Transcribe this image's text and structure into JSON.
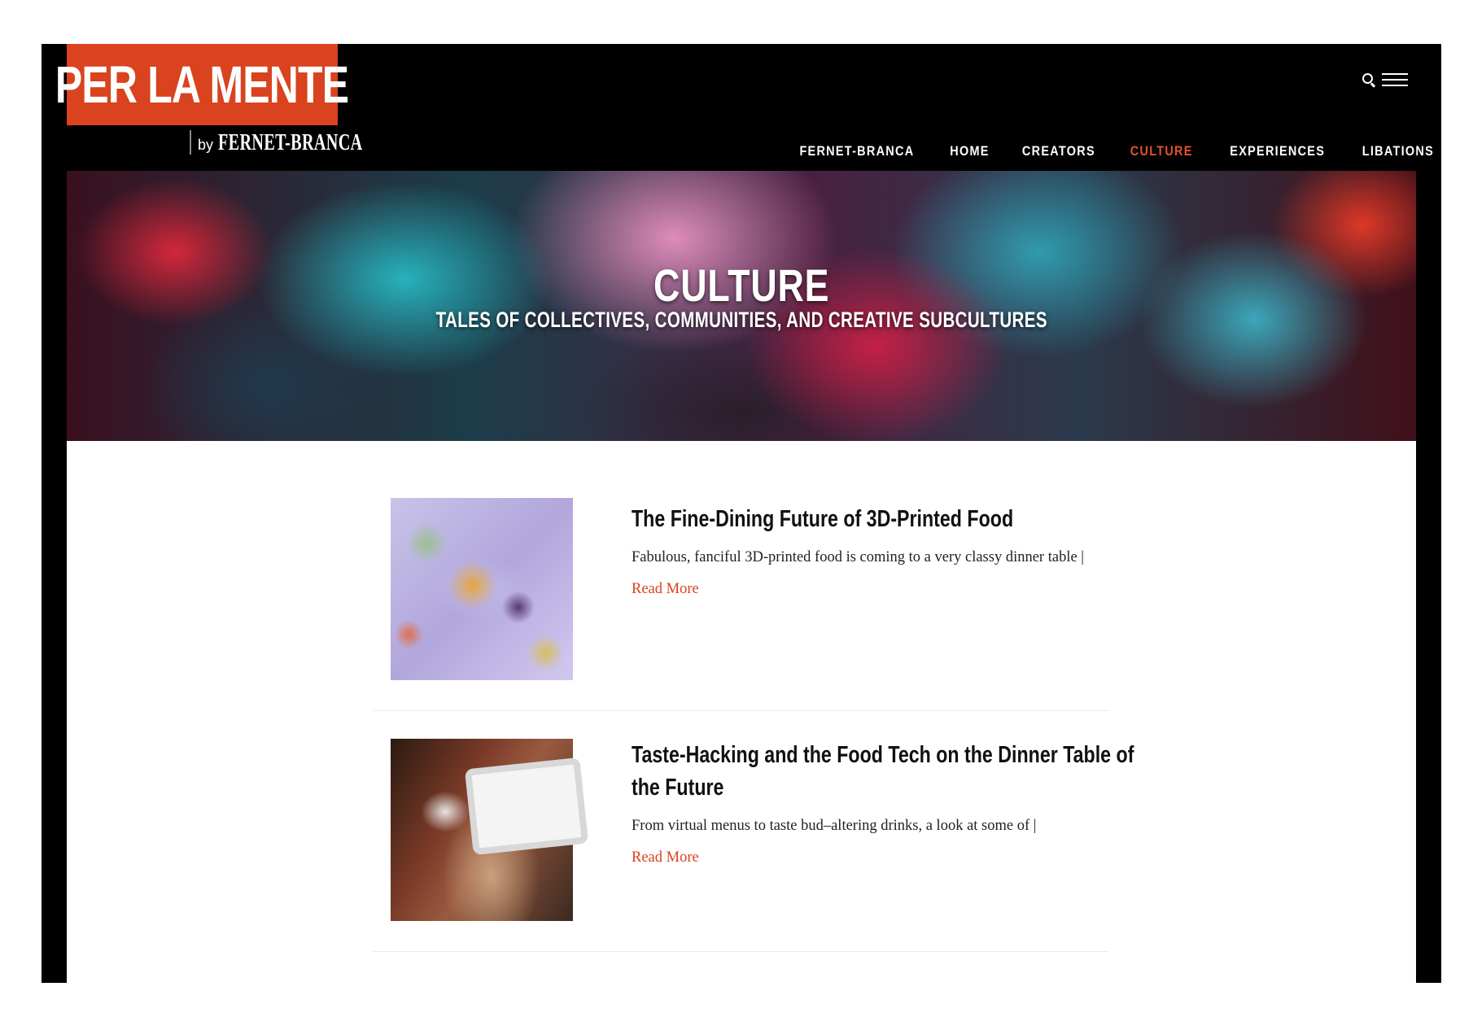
{
  "logo": {
    "title": "PER LA MENTE",
    "by": "by",
    "brand": "FERNET-BRANCA"
  },
  "header": {
    "icons": [
      "search-icon",
      "menu-icon"
    ]
  },
  "nav": {
    "items": [
      {
        "label": "FERNET-BRANCA",
        "active": false
      },
      {
        "label": "HOME",
        "active": false
      },
      {
        "label": "CREATORS",
        "active": false
      },
      {
        "label": "CULTURE",
        "active": true
      },
      {
        "label": "EXPERIENCES",
        "active": false
      },
      {
        "label": "LIBATIONS",
        "active": false
      }
    ]
  },
  "hero": {
    "title": "CULTURE",
    "subtitle": "TALES OF COLLECTIVES, COMMUNITIES, AND CREATIVE SUBCULTURES"
  },
  "articles": [
    {
      "headline_line1": "The Fine-Dining Future of 3D-Printed Food",
      "headline_line2": "",
      "excerpt": "Fabulous, fanciful 3D-printed food is coming to a very classy dinner table | ",
      "read_more": "Read More"
    },
    {
      "headline_line1": "Taste-Hacking and the Food Tech on the Dinner Table of",
      "headline_line2": "the Future",
      "excerpt": "From virtual menus to taste bud–altering drinks, a look at some of | ",
      "read_more": "Read More"
    }
  ],
  "colors": {
    "accent": "#d9431f",
    "nav_active": "#e2522c",
    "background": "#000000"
  }
}
